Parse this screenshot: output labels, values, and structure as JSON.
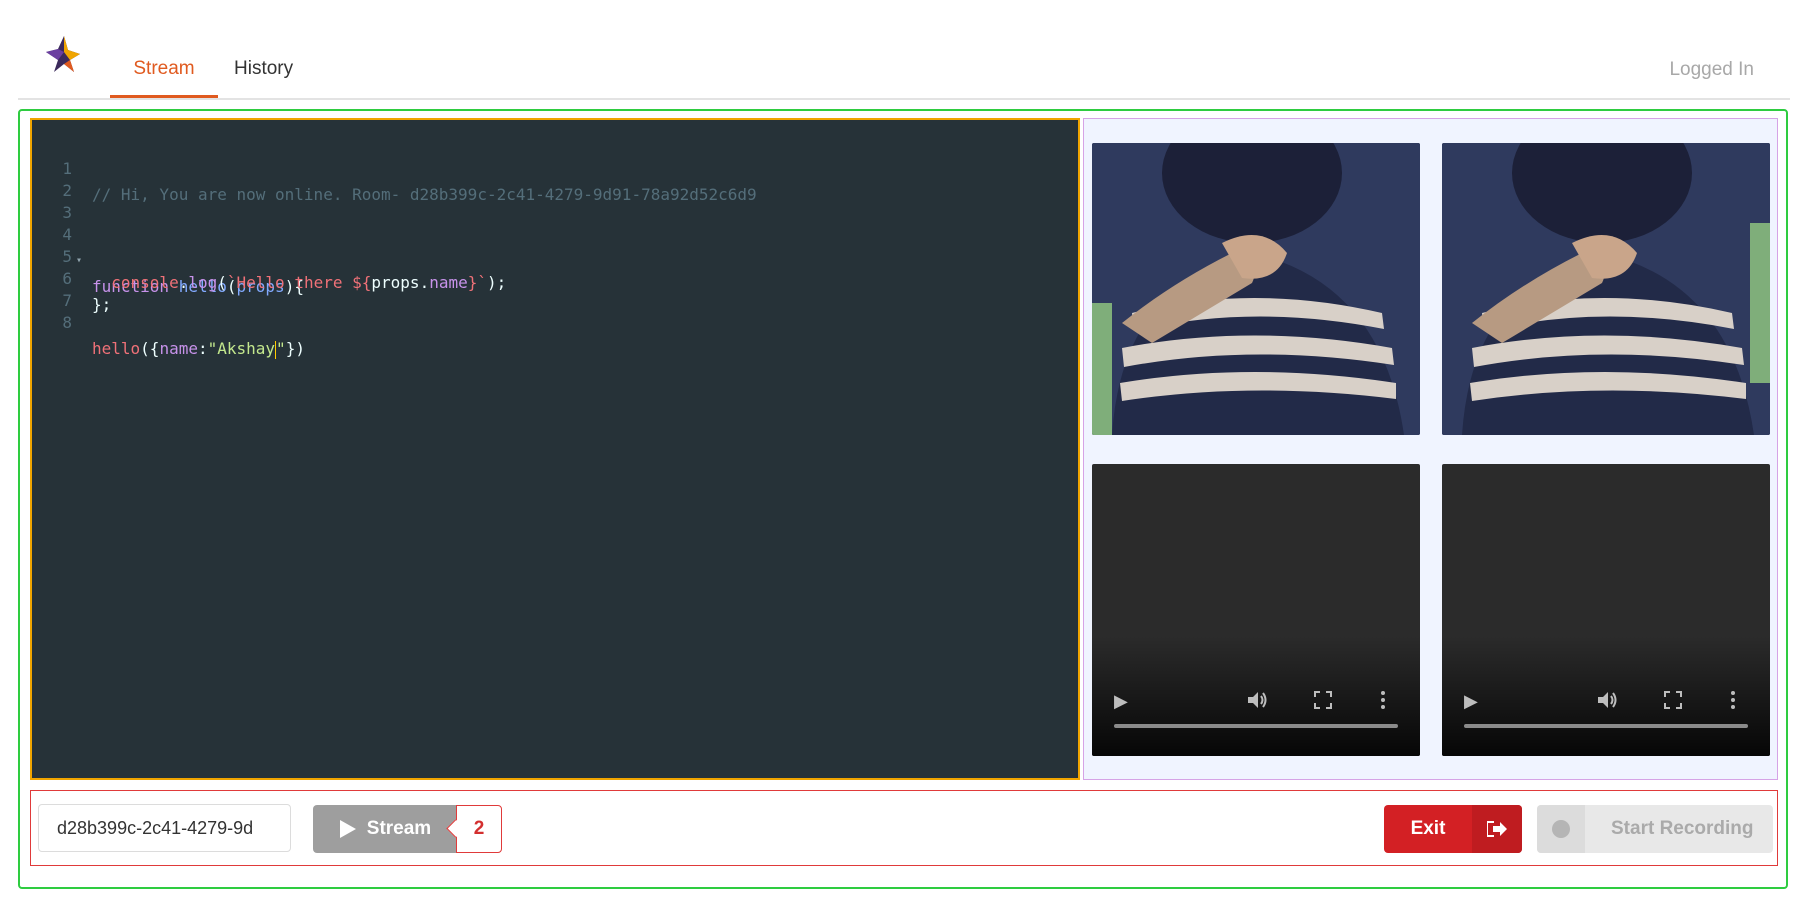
{
  "nav": {
    "tabs": [
      {
        "label": "Stream",
        "active": true
      },
      {
        "label": "History",
        "active": false
      }
    ],
    "status": "Logged In"
  },
  "editor": {
    "lines": [
      {
        "num": "1"
      },
      {
        "num": "2"
      },
      {
        "num": "3"
      },
      {
        "num": "4"
      },
      {
        "num": "5"
      },
      {
        "num": "6"
      },
      {
        "num": "7"
      },
      {
        "num": "8"
      }
    ],
    "comment": "// Hi, You are now online. Room- d28b399c-2c41-4279-9d91-78a92d52c6d9",
    "kw_function": "function",
    "fn_hello": "hello",
    "param_props": "props",
    "obj_console": "console",
    "method_log": "log",
    "tpl_text": "`Hello there ${",
    "tpl_props": "props",
    "tpl_name": "name",
    "tpl_end": "}`",
    "key_name": "name",
    "str_akshay_a": "\"Akshay",
    "str_akshay_b": "\""
  },
  "bottom": {
    "room_value": "d28b399c-2c41-4279-9d",
    "stream_label": "Stream",
    "stream_count": "2",
    "exit_label": "Exit",
    "record_label": "Start Recording"
  },
  "colors": {
    "accent": "#e05a1f",
    "frame_border": "#2ecc40",
    "editor_border": "#f0a500",
    "danger": "#d32024"
  },
  "icons": [
    "app-logo-icon",
    "play-icon",
    "sign-out-icon",
    "record-dot-icon",
    "volume-icon",
    "fullscreen-icon",
    "more-vert-icon"
  ]
}
